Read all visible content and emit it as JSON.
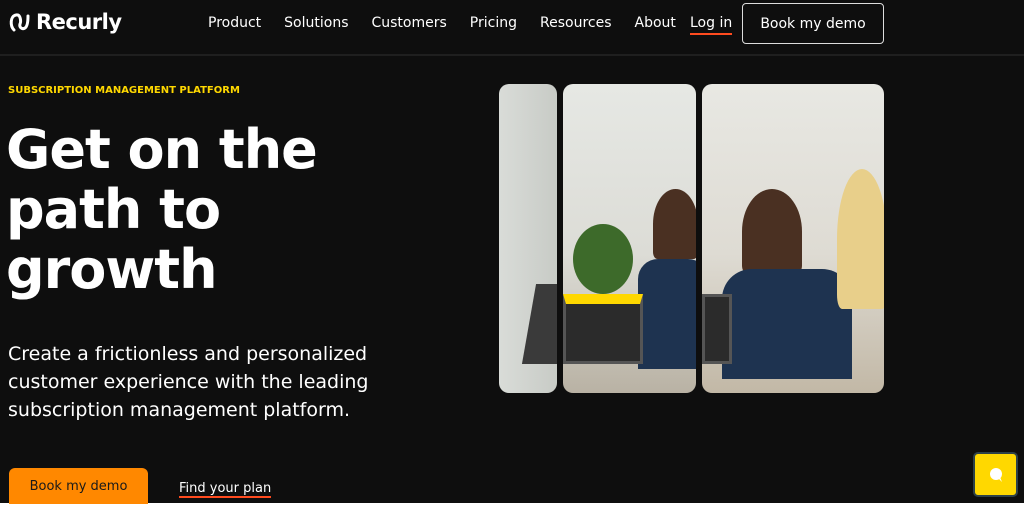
{
  "nav": {
    "logo": "Recurly",
    "items": [
      "Product",
      "Solutions",
      "Customers",
      "Pricing",
      "Resources",
      "About"
    ],
    "login": "Log in",
    "demo": "Book my demo"
  },
  "hero": {
    "eyebrow": "SUBSCRIPTION MANAGEMENT PLATFORM",
    "title_lines": [
      "Get on the",
      "path to",
      "growth"
    ],
    "subtitle": "Create a frictionless and personalized customer experience with the leading subscription management platform.",
    "cta": "Book my demo",
    "secondary": "Find your plan"
  },
  "colors": {
    "accent": "#ff8800",
    "eyebrow": "#ffd800",
    "underline": "#ff4b1f",
    "background": "#0e0e0e"
  }
}
